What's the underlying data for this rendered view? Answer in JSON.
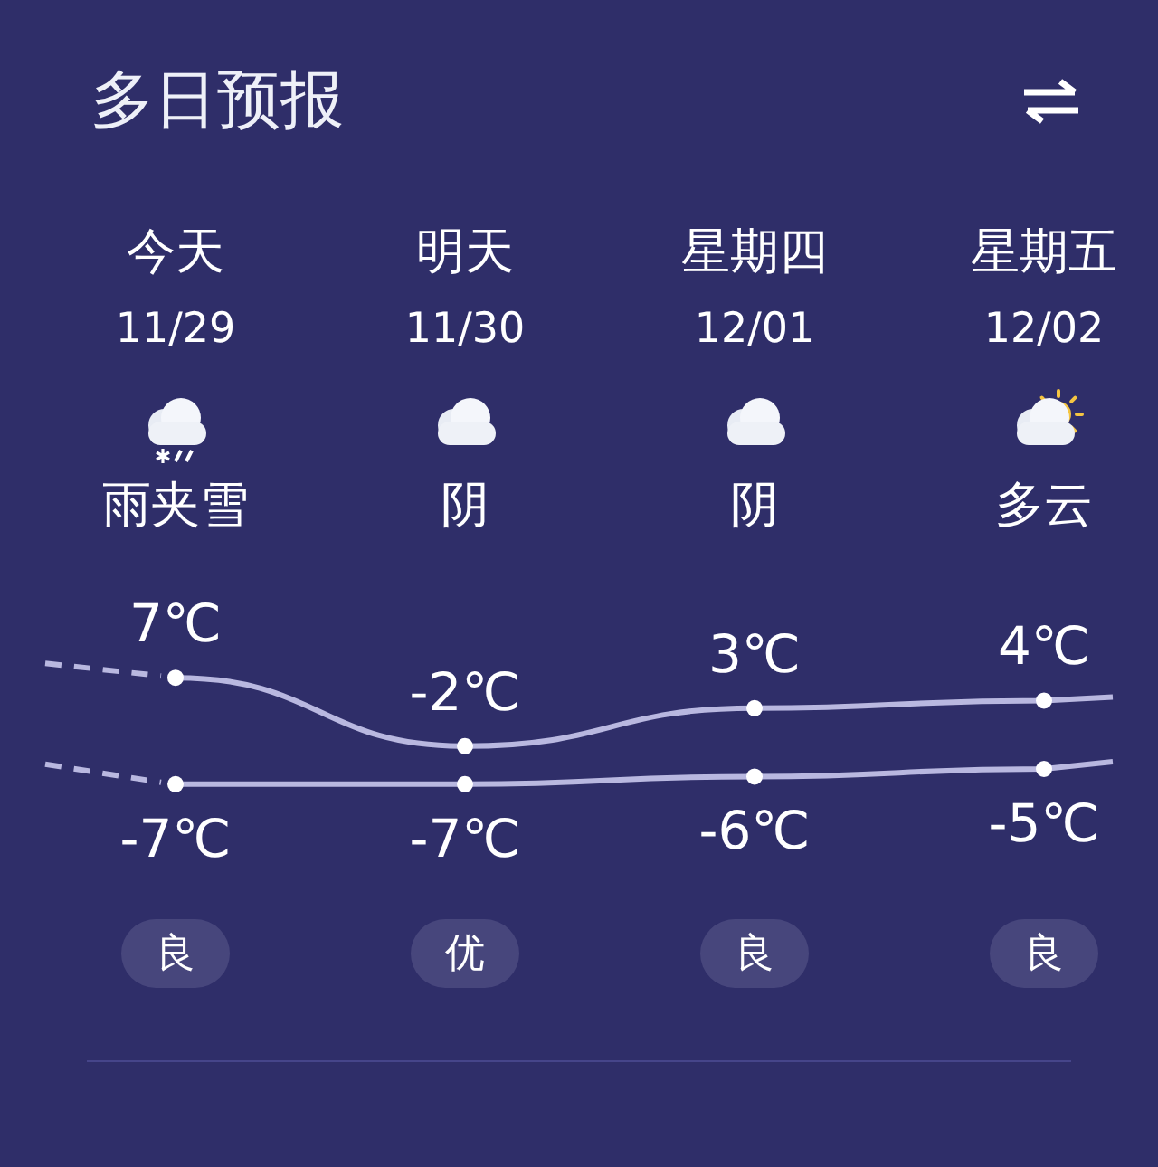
{
  "title": "多日预报",
  "days": [
    {
      "day": "今天",
      "date": "11/29",
      "kind": "sleet",
      "condition": "雨夹雪",
      "high": "7℃",
      "low": "-7℃",
      "air": "良"
    },
    {
      "day": "明天",
      "date": "11/30",
      "kind": "overcast",
      "condition": "阴",
      "high": "-2℃",
      "low": "-7℃",
      "air": "优"
    },
    {
      "day": "星期四",
      "date": "12/01",
      "kind": "overcast",
      "condition": "阴",
      "high": "3℃",
      "low": "-6℃",
      "air": "良"
    },
    {
      "day": "星期五",
      "date": "12/02",
      "kind": "partly_cloudy",
      "condition": "多云",
      "high": "4℃",
      "low": "-5℃",
      "air": "良"
    }
  ]
}
